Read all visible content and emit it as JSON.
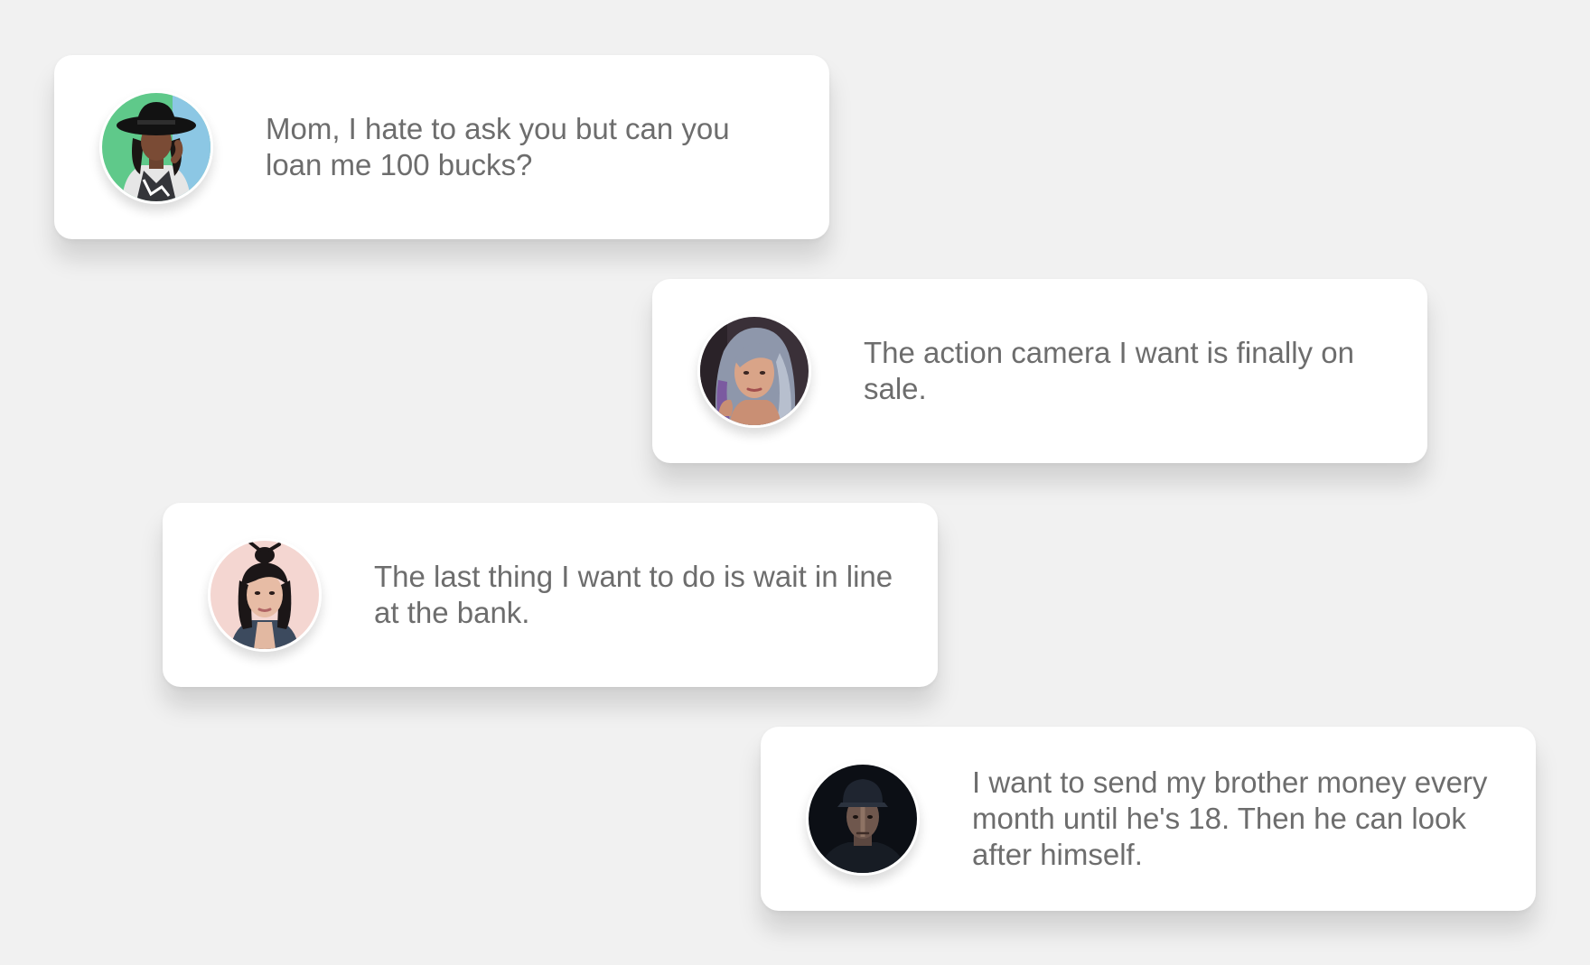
{
  "messages": [
    {
      "id": "card-1",
      "avatar": "woman-black-hat-avatar",
      "text": "Mom, I hate to ask you but can you loan me 100 bucks?"
    },
    {
      "id": "card-2",
      "avatar": "woman-silver-hair-avatar",
      "text": "The action camera I want is finally on sale."
    },
    {
      "id": "card-3",
      "avatar": "woman-dark-hair-pink-bg-avatar",
      "text": "The last thing I want to do is wait in line at the bank."
    },
    {
      "id": "card-4",
      "avatar": "man-cap-dark-bg-avatar",
      "text": "I want to send my brother money every month until he's 18. Then he can look after himself."
    }
  ],
  "colors": {
    "background": "#f1f1f1",
    "card": "#ffffff",
    "text": "#6d6d6d"
  }
}
